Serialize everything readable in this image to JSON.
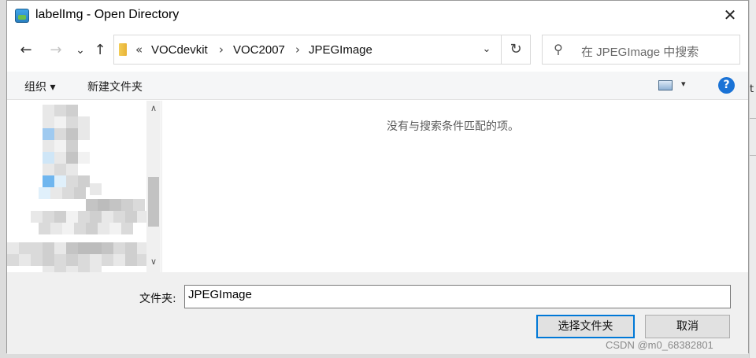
{
  "window": {
    "title": "labelImg - Open Directory",
    "close_glyph": "✕"
  },
  "nav": {
    "back_glyph": "←",
    "forward_glyph": "→",
    "recent_glyph": "⌄",
    "up_glyph": "↑",
    "breadcrumb_overflow": "«",
    "breadcrumb": [
      "VOCdevkit",
      "VOC2007",
      "JPEGImage"
    ],
    "separator": "›",
    "dropdown_glyph": "⌄",
    "refresh_glyph": "↻"
  },
  "search": {
    "placeholder": "在 JPEGImage 中搜索",
    "icon": "search-icon"
  },
  "toolbar": {
    "organize_label": "组织 ▾",
    "new_folder_label": "新建文件夹",
    "view_caret": "▾",
    "help_glyph": "?"
  },
  "content": {
    "empty_message": "没有与搜索条件匹配的项。"
  },
  "tree_scroll": {
    "up_glyph": "∧",
    "down_glyph": "∨"
  },
  "footer": {
    "folder_label": "文件夹:",
    "folder_value": "JPEGImage",
    "select_label": "选择文件夹",
    "cancel_label": "取消"
  },
  "watermark": "CSDN @m0_68382801",
  "background_glyph": "t",
  "colors": {
    "accent": "#0078d7",
    "help": "#1a73d6",
    "folder": "#e8b337"
  }
}
